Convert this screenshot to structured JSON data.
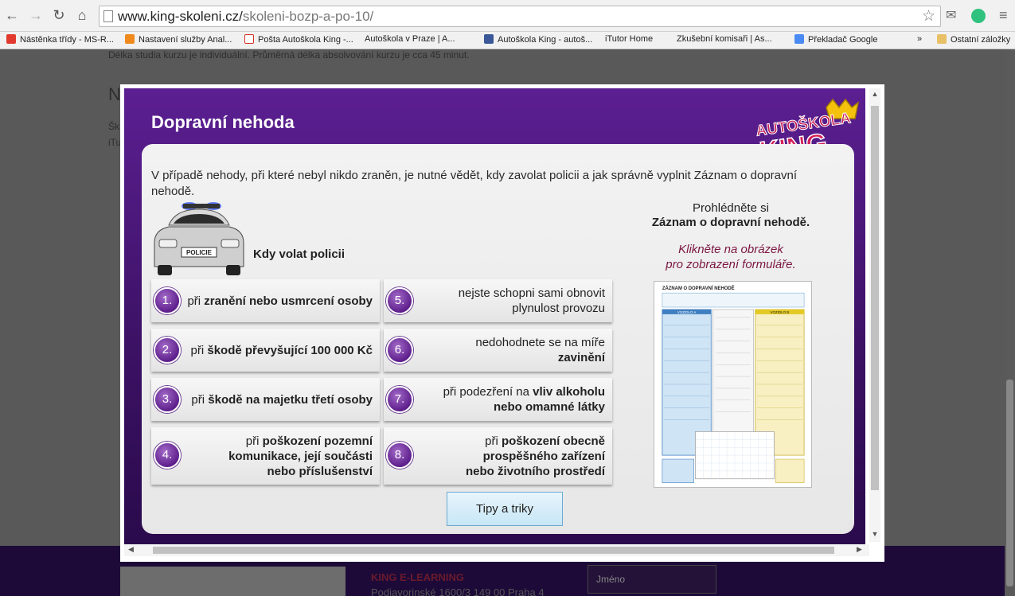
{
  "browser": {
    "url_domain": "www.king-skoleni.cz/",
    "url_path": "skoleni-bozp-a-po-10/",
    "bookmarks": [
      {
        "label": "Nástěnka třídy - MS-R...",
        "color": "#e23a2e"
      },
      {
        "label": "Nastavení služby Anal...",
        "color": "#f08a1c"
      },
      {
        "label": "Pošta Autoškola King -...",
        "color": "#d93025"
      },
      {
        "label": "Autoškola v Praze | A...",
        "color": "#ffffff"
      },
      {
        "label": "Autoškola King - autoš...",
        "color": "#3b5998"
      },
      {
        "label": "iTutor Home",
        "color": "#ffffff"
      },
      {
        "label": "Zkušební komisaři | As...",
        "color": "#ffffff"
      },
      {
        "label": "Překladač Google",
        "color": "#4a8af4"
      }
    ],
    "more": "»",
    "other_bookmarks": "Ostatní záložky"
  },
  "page": {
    "line1": "Délka studia kurzu je individuální. Průměrná délka absolvování kurzu je cca 45 minut.",
    "heading_fragment": "N",
    "frag2": "Šk",
    "frag3": "iTu",
    "footer_title": "KING E-LEARNING",
    "footer_address": "Podjavorinské 1600/3 149 00 Praha 4",
    "footer_name_placeholder": "Jméno"
  },
  "modal": {
    "title": "Dopravní nehoda",
    "logo_text_top": "AUTOŠKOLA",
    "logo_text_bottom": "KING",
    "intro": "V případě nehody, při které nebyl nikdo zraněn, je nutné vědět, kdy zavolat policii a jak správně vyplnit Záznam o dopravní nehodě.",
    "car_label": "POLICIE",
    "subtitle": "Kdy volat policii",
    "view_line1": "Prohlédněte si",
    "view_line2": "Záznam o dopravní nehodě.",
    "click_line1": "Klikněte na obrázek",
    "click_line2": "pro zobrazení formuláře.",
    "form_title": "ZÁZNAM O DOPRAVNÍ NEHODĚ",
    "form_vehicle_a": "VOZIDLO A",
    "form_vehicle_b": "VOZIDLO B",
    "tips_button": "Tipy a triky",
    "items": [
      {
        "num": "1.",
        "pre": "při ",
        "bold": "zranění nebo usmrcení osoby",
        "post": ""
      },
      {
        "num": "2.",
        "pre": "při ",
        "bold": "škodě převyšující 100 000 Kč",
        "post": ""
      },
      {
        "num": "3.",
        "pre": "při ",
        "bold": "škodě na majetku třetí osoby",
        "post": ""
      },
      {
        "num": "4.",
        "pre": "při ",
        "bold": "poškození pozemní komunikace, její součásti nebo příslušenství",
        "post": ""
      },
      {
        "num": "5.",
        "pre": "",
        "bold": "",
        "post": "nejste schopni sami obnovit plynulost provozu"
      },
      {
        "num": "6.",
        "pre": "nedohodnete se na míře ",
        "bold": "zavinění",
        "post": ""
      },
      {
        "num": "7.",
        "pre": "při podezření na ",
        "bold": "vliv alkoholu nebo omamné látky",
        "post": ""
      },
      {
        "num": "8.",
        "pre": "při ",
        "bold": "poškození obecně prospěšného zařízení nebo životního prostředí",
        "post": ""
      }
    ]
  },
  "colors": {
    "stage_purple": "#4a1678",
    "number_badge": "#7a3aa6",
    "link_maroon": "#7b1640",
    "tips_button_bg": "#d4ecf8"
  }
}
